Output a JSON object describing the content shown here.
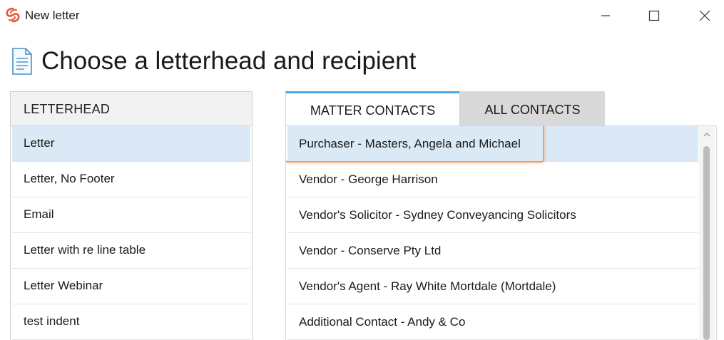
{
  "window": {
    "title": "New letter",
    "app_icon": "swirl-logo-icon",
    "controls": [
      "minimize-icon",
      "maximize-icon",
      "close-icon"
    ]
  },
  "page": {
    "icon": "document-icon",
    "title": "Choose a letterhead and recipient"
  },
  "letterhead": {
    "header": "LETTERHEAD",
    "items": [
      {
        "label": "Letter",
        "selected": true
      },
      {
        "label": "Letter, No Footer",
        "selected": false
      },
      {
        "label": "Email",
        "selected": false
      },
      {
        "label": "Letter with re line table",
        "selected": false
      },
      {
        "label": "Letter Webinar",
        "selected": false
      },
      {
        "label": "test indent",
        "selected": false
      }
    ]
  },
  "tabs": [
    {
      "label": "MATTER CONTACTS",
      "active": true
    },
    {
      "label": "ALL CONTACTS",
      "active": false
    }
  ],
  "contacts": [
    {
      "label": "Purchaser - Masters, Angela and Michael",
      "selected": true,
      "highlighted": true
    },
    {
      "label": "Vendor - George Harrison",
      "selected": false
    },
    {
      "label": "Vendor's Solicitor - Sydney Conveyancing Solicitors",
      "selected": false
    },
    {
      "label": "Vendor - Conserve Pty Ltd",
      "selected": false
    },
    {
      "label": "Vendor's Agent - Ray White Mortdale (Mortdale)",
      "selected": false
    },
    {
      "label": "Additional Contact - Andy & Co",
      "selected": false
    }
  ],
  "colors": {
    "selection": "#dbe9f7",
    "active_tab_accent": "#4aa8e6",
    "highlight_outline": "#f0a060",
    "brand": "#e8553a"
  }
}
